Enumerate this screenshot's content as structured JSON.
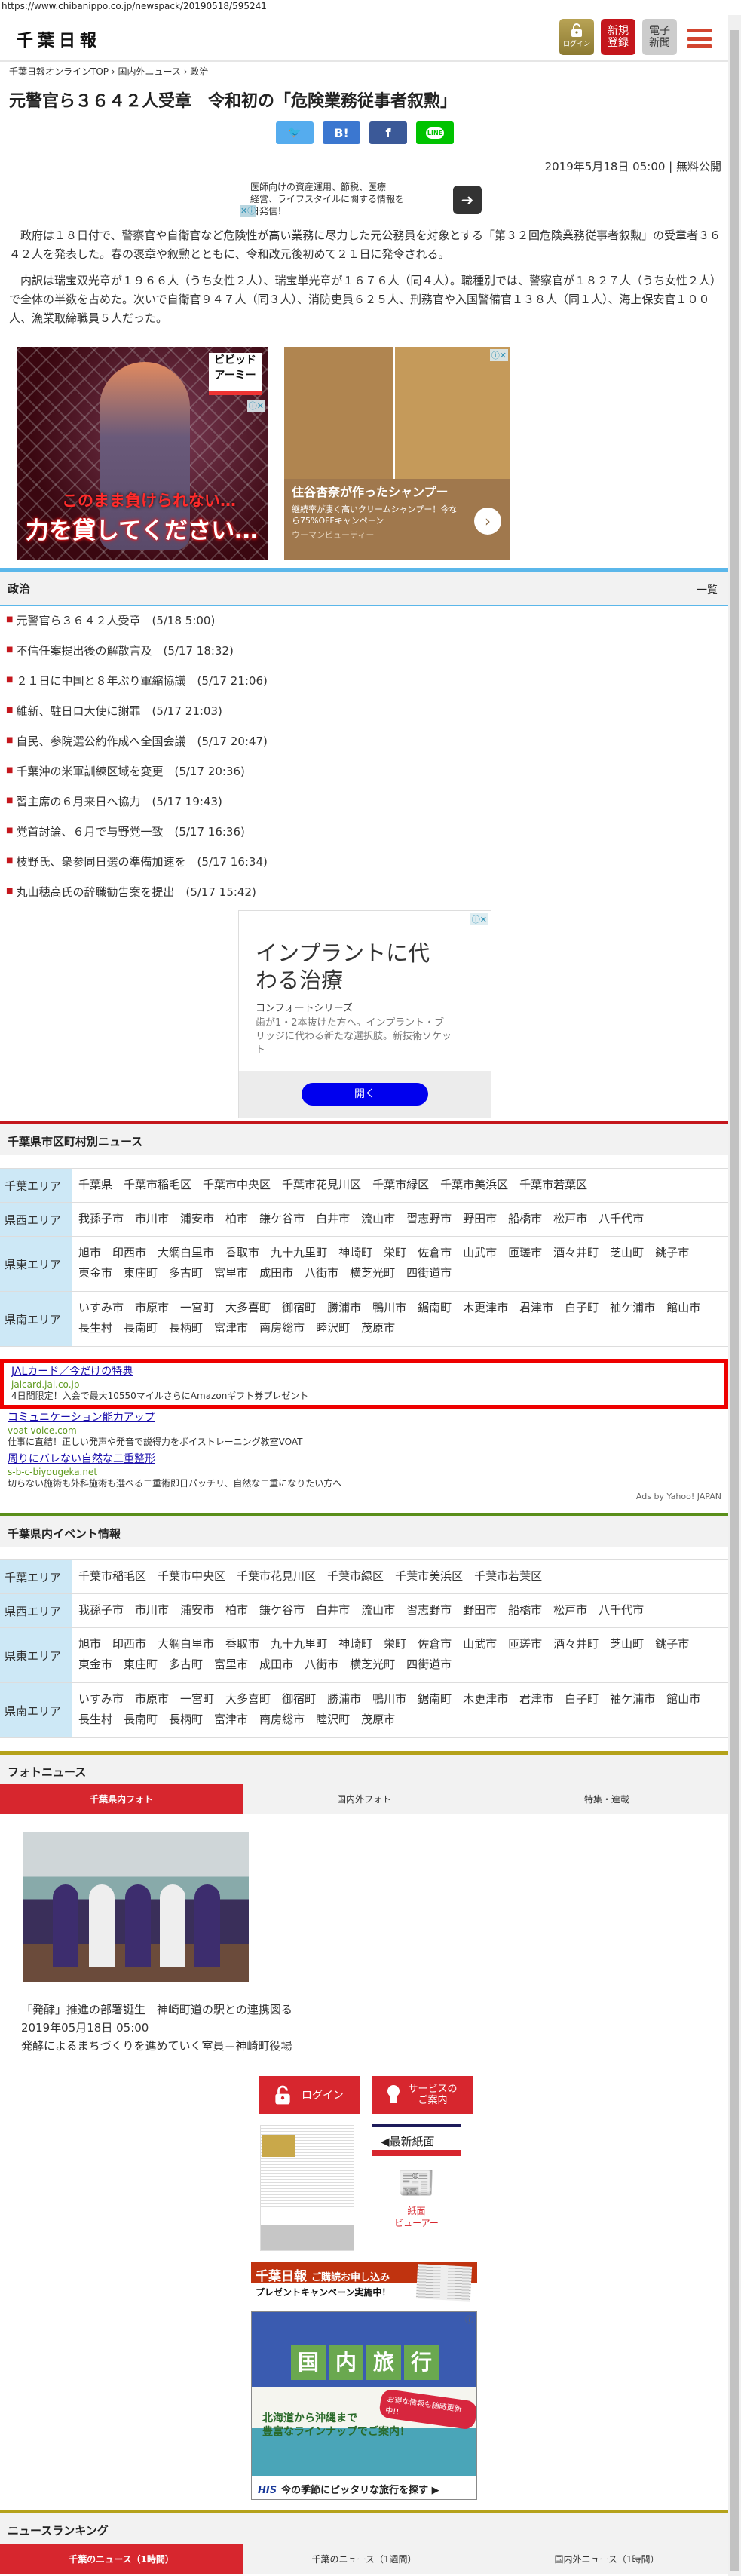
{
  "browser": {
    "url": "https://www.chibanippo.co.jp/newspack/20190518/595241"
  },
  "header": {
    "logo": "千葉日報",
    "login": "ログイン",
    "register": "新規\n登録",
    "register_l1": "新規",
    "register_l2": "登録",
    "epaper_l1": "電子",
    "epaper_l2": "新聞",
    "menu_icon": "hamburger-icon"
  },
  "breadcrumb": [
    "千葉日報オンラインTOP",
    "国内外ニュース",
    "政治"
  ],
  "breadcrumb_sep": "›",
  "article": {
    "title": "元警官ら３６４２人受章　令和初の「危険業務従事者叙勲」",
    "share": {
      "twitter": "🐦",
      "hatena": "B!",
      "facebook": "f",
      "line": "LINE"
    },
    "date": "2019年5月18日 05:00 | 無料公開",
    "paragraphs": [
      "政府は１８日付で、警察官や自衛官など危険性が高い業務に尽力した元公務員を対象とする「第３２回危険業務従事者叙勲」の受章者３６４２人を発表した。春の褒章や叙勲とともに、令和改元後初めて２１日に発令される。",
      "内訳は瑞宝双光章が１９６６人（うち女性２人）、瑞宝単光章が１６７６人（同４人）。職種別では、警察官が１８２７人（うち女性２人）で全体の半数を占めた。次いで自衛官９４７人（同３人）、消防吏員６２５人、刑務官や入国警備官１３８人（同１人）、海上保安官１００人、漁業取締職員５人だった。"
    ]
  },
  "ads": {
    "top_text": "医師向けの資産運用、節税、医療経営、ライフスタイルに関する情報を日発信！",
    "top_text_a": "医師向けの資産運用、節税、医療",
    "top_text_b": "経営、ライフスタイルに関する情報を",
    "top_text_c": "日発信！",
    "anime": {
      "brand": "ビビッド\nアーミー",
      "brand_l1": "ビビッド",
      "brand_l2": "アーミー",
      "line1": "このまま負けられない…",
      "line2": "力を貸してください…"
    },
    "hair": {
      "headline": "住谷杏奈が作ったシャンプー",
      "desc": "継続率が凄く高いクリームシャンプー！今なら75%OFFキャンペーン",
      "sponsor": "ウーマンビューティー"
    },
    "implant": {
      "headline": "インプラントに代わる治療",
      "brand": "コンフォートシリーズ",
      "desc": "歯が1・2本抜けた方へ。インプラント・ブリッジに代わる新たな選択肢。新技術ソケット",
      "button": "開く"
    },
    "yahoo": [
      {
        "title": "JALカード／今だけの特典",
        "url": "jalcard.jal.co.jp",
        "desc": "4日間限定！入会で最大10550マイルさらにAmazonギフト券プレゼント"
      },
      {
        "title": "コミュニケーション能力アップ",
        "url": "voat-voice.com",
        "desc": "仕事に直結！正しい発声や発音で説得力をボイストレーニング教室VOAT"
      },
      {
        "title": "周りにバレない自然な二重整形",
        "url": "s-b-c-biyougeka.net",
        "desc": "切らない施術も外科施術も選べる二重術即日パッチリ、自然な二重になりたい方へ"
      }
    ],
    "yahoo_credit": "Ads by Yahoo! JAPAN",
    "subscribe": {
      "logo": "千葉日報",
      "title": "ご購読お申し込み",
      "sub": "プレゼントキャンペーン実施中！"
    },
    "his": {
      "heading": [
        "国",
        "内",
        "旅",
        "行"
      ],
      "sub1": "北海道から沖縄まで",
      "sub2": "豊富なラインナップでご案内！",
      "badge": "お得な情報も随時更新中!!",
      "brand": "HIS",
      "footer": "今の季節にピッタリな旅行を探す ▶"
    }
  },
  "politics": {
    "heading": "政治",
    "more": "一覧",
    "items": [
      {
        "title": "元警官ら３６４２人受章",
        "time": "(5/18 5:00)"
      },
      {
        "title": "不信任案提出後の解散言及",
        "time": "(5/17 18:32)"
      },
      {
        "title": "２１日に中国と８年ぶり軍縮協議",
        "time": "(5/17 21:06)"
      },
      {
        "title": "維新、駐日ロ大使に謝罪",
        "time": "(5/17 21:03)"
      },
      {
        "title": "自民、参院選公約作成へ全国会議",
        "time": "(5/17 20:47)"
      },
      {
        "title": "千葉沖の米軍訓練区域を変更",
        "time": "(5/17 20:36)"
      },
      {
        "title": "習主席の６月来日へ協力",
        "time": "(5/17 19:43)"
      },
      {
        "title": "党首討論、６月で与野党一致",
        "time": "(5/17 16:36)"
      },
      {
        "title": "枝野氏、衆参同日選の準備加速を",
        "time": "(5/17 16:34)"
      },
      {
        "title": "丸山穂高氏の辞職勧告案を提出",
        "time": "(5/17 15:42)"
      }
    ]
  },
  "city_news": {
    "heading": "千葉県市区町村別ニュース",
    "areas": [
      {
        "label": "千葉エリア",
        "cities": [
          "千葉県",
          "千葉市稲毛区",
          "千葉市中央区",
          "千葉市花見川区",
          "千葉市緑区",
          "千葉市美浜区",
          "千葉市若葉区"
        ]
      },
      {
        "label": "県西エリア",
        "cities": [
          "我孫子市",
          "市川市",
          "浦安市",
          "柏市",
          "鎌ケ谷市",
          "白井市",
          "流山市",
          "習志野市",
          "野田市",
          "船橋市",
          "松戸市",
          "八千代市"
        ]
      },
      {
        "label": "県東エリア",
        "cities": [
          "旭市",
          "印西市",
          "大網白里市",
          "香取市",
          "九十九里町",
          "神崎町",
          "栄町",
          "佐倉市",
          "山武市",
          "匝瑳市",
          "酒々井町",
          "芝山町",
          "銚子市",
          "東金市",
          "東庄町",
          "多古町",
          "富里市",
          "成田市",
          "八街市",
          "横芝光町",
          "四街道市"
        ]
      },
      {
        "label": "県南エリア",
        "cities": [
          "いすみ市",
          "市原市",
          "一宮町",
          "大多喜町",
          "御宿町",
          "勝浦市",
          "鴨川市",
          "鋸南町",
          "木更津市",
          "君津市",
          "白子町",
          "袖ケ浦市",
          "館山市",
          "長生村",
          "長南町",
          "長柄町",
          "富津市",
          "南房総市",
          "睦沢町",
          "茂原市"
        ]
      }
    ]
  },
  "events": {
    "heading": "千葉県内イベント情報",
    "areas": [
      {
        "label": "千葉エリア",
        "cities": [
          "千葉市稲毛区",
          "千葉市中央区",
          "千葉市花見川区",
          "千葉市緑区",
          "千葉市美浜区",
          "千葉市若葉区"
        ]
      },
      {
        "label": "県西エリア",
        "cities": [
          "我孫子市",
          "市川市",
          "浦安市",
          "柏市",
          "鎌ケ谷市",
          "白井市",
          "流山市",
          "習志野市",
          "野田市",
          "船橋市",
          "松戸市",
          "八千代市"
        ]
      },
      {
        "label": "県東エリア",
        "cities": [
          "旭市",
          "印西市",
          "大網白里市",
          "香取市",
          "九十九里町",
          "神崎町",
          "栄町",
          "佐倉市",
          "山武市",
          "匝瑳市",
          "酒々井町",
          "芝山町",
          "銚子市",
          "東金市",
          "東庄町",
          "多古町",
          "富里市",
          "成田市",
          "八街市",
          "横芝光町",
          "四街道市"
        ]
      },
      {
        "label": "県南エリア",
        "cities": [
          "いすみ市",
          "市原市",
          "一宮町",
          "大多喜町",
          "御宿町",
          "勝浦市",
          "鴨川市",
          "鋸南町",
          "木更津市",
          "君津市",
          "白子町",
          "袖ケ浦市",
          "館山市",
          "長生村",
          "長南町",
          "長柄町",
          "富津市",
          "南房総市",
          "睦沢町",
          "茂原市"
        ]
      }
    ]
  },
  "photo_news": {
    "heading": "フォトニュース",
    "tabs": [
      "千葉県内フォト",
      "国内外フォト",
      "特集・連載"
    ],
    "active_tab": 0,
    "caption": "「発酵」推進の部署誕生　神崎町道の駅との連携図る",
    "date": "2019年05月18日 05:00",
    "desc": "発酵によるまちづくりを進めていく室員＝神崎町役場"
  },
  "services": {
    "login": "ログイン",
    "guide_l1": "サービスの",
    "guide_l2": "ご案内",
    "latest": "◀最新紙面",
    "viewer_l1": "紙面",
    "viewer_l2": "ビューアー"
  },
  "ranking": {
    "heading": "ニュースランキング",
    "tabs": [
      "千葉のニュース（1時間）",
      "千葉のニュース（1週間）",
      "国内外ニュース（1時間）"
    ],
    "active_tab": 0
  },
  "colors": {
    "red": "#d7262e",
    "politics": "#5bb7ea",
    "events": "#5a8f1a",
    "photo": "#b5a21a",
    "area": "#cde8f6"
  }
}
